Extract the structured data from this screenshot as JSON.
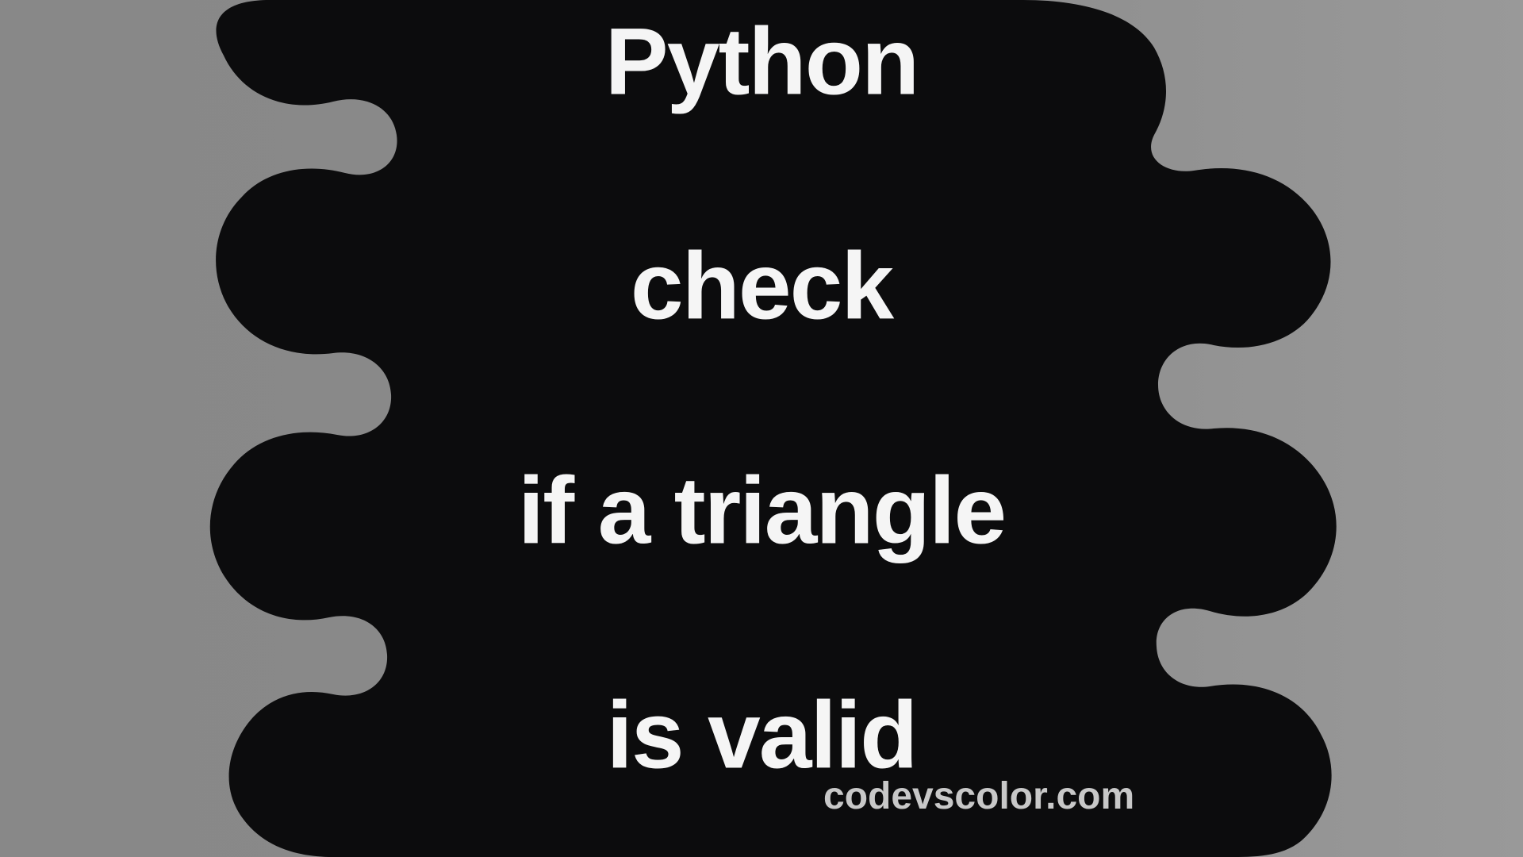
{
  "title_line1": "Python",
  "title_line2": "check",
  "title_line3": "if a triangle",
  "title_line4": "is valid",
  "watermark": "codevscolor.com",
  "colors": {
    "blob": "#0c0c0d",
    "title": "#f5f5f5",
    "watermark": "#c8c8c8",
    "bg": "#888888"
  }
}
